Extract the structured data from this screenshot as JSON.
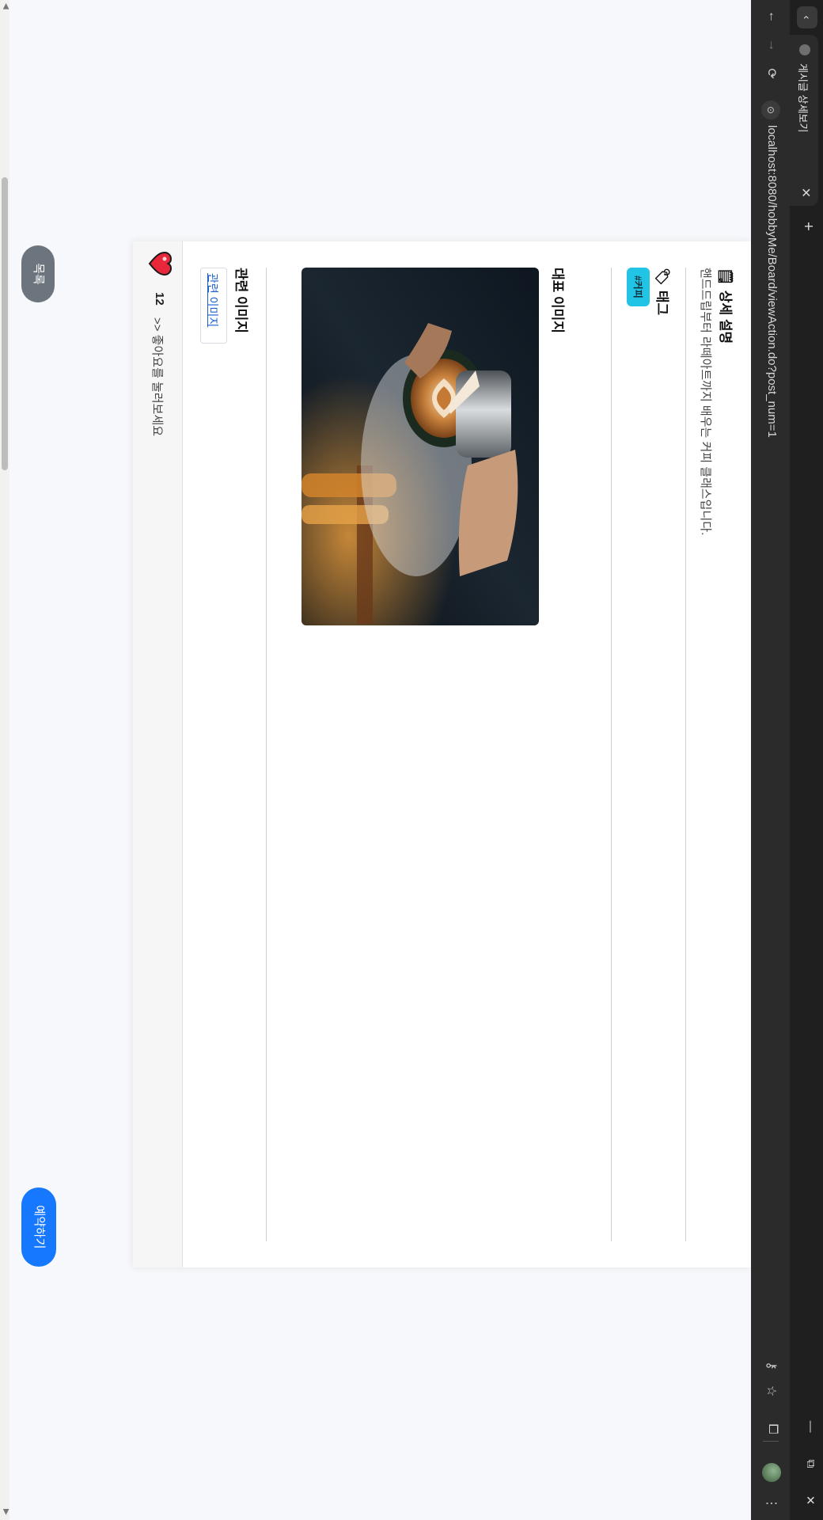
{
  "browser": {
    "tab_title": "게시글 상세보기",
    "url": "localhost:8080/hobbyMe/Board/viewAction.do?post_num=1",
    "nav_left": "‹",
    "tab_close": "✕",
    "new_tab": "+",
    "minimize": "—",
    "restore": "⧉",
    "close": "✕",
    "back": "←",
    "forward": "→",
    "reload": "⟳",
    "site_info": "⊙",
    "key_icon": "⚷",
    "star": "☆",
    "extensions": "⧠",
    "menu": "⋮"
  },
  "post": {
    "description_title": "상세 설명",
    "description_emoji": "🗒",
    "description": "핸드드립부터 라떼아트까지 배우는 커피 클래스입니다.",
    "tags_title": "태그",
    "tags_emoji": "🏷",
    "tags": [
      "#커피"
    ],
    "main_image_title": "대표 이미지",
    "related_image_title": "관련 이미지",
    "related_image_alt": "관련 이미지"
  },
  "likes": {
    "count": "12",
    "hint": ">> 좋아요를 눌러보세요"
  },
  "actions": {
    "list_label": "목록",
    "reserve_label": "예약하기"
  },
  "colors": {
    "primary": "#1677ff",
    "secondary": "#6c757d",
    "tag": "#22c4e6",
    "heart": "#e8273a"
  }
}
